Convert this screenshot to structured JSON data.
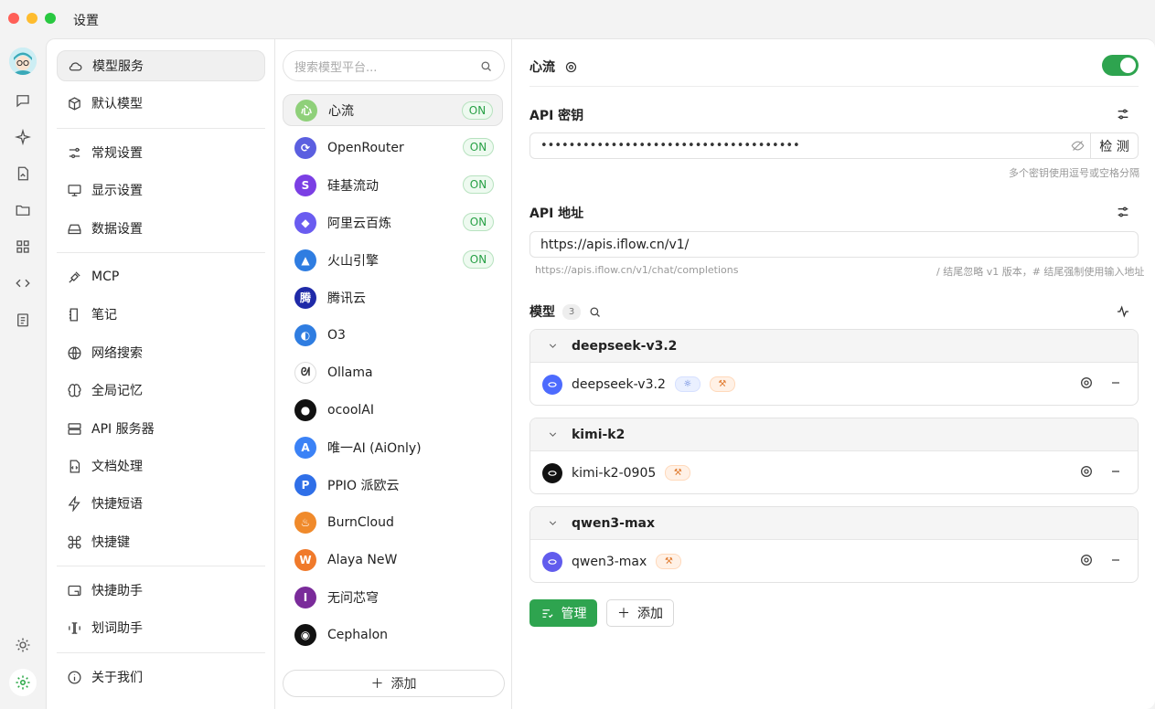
{
  "window": {
    "title": "设置"
  },
  "nav": {
    "items": [
      {
        "label": "模型服务",
        "icon": "cloud-icon"
      },
      {
        "label": "默认模型",
        "icon": "cube-icon"
      },
      {
        "label": "常规设置",
        "icon": "sliders-icon"
      },
      {
        "label": "显示设置",
        "icon": "monitor-gear-icon"
      },
      {
        "label": "数据设置",
        "icon": "hard-drive-icon"
      },
      {
        "label": "MCP",
        "icon": "plug-icon"
      },
      {
        "label": "笔记",
        "icon": "notebook-pen-icon"
      },
      {
        "label": "网络搜索",
        "icon": "globe-icon"
      },
      {
        "label": "全局记忆",
        "icon": "brain-icon"
      },
      {
        "label": "API 服务器",
        "icon": "server-icon"
      },
      {
        "label": "文档处理",
        "icon": "file-code-icon"
      },
      {
        "label": "快捷短语",
        "icon": "zap-icon"
      },
      {
        "label": "快捷键",
        "icon": "command-icon"
      },
      {
        "label": "快捷助手",
        "icon": "app-window-icon"
      },
      {
        "label": "划词助手",
        "icon": "text-cursor-icon"
      },
      {
        "label": "关于我们",
        "icon": "info-icon"
      }
    ]
  },
  "providers": {
    "search_placeholder": "搜索模型平台...",
    "items": [
      {
        "name": "心流",
        "on": "ON",
        "logo_text": "心",
        "color": "#8fd07a"
      },
      {
        "name": "OpenRouter",
        "on": "ON",
        "logo_text": "⟳",
        "color": "#5b5fe0"
      },
      {
        "name": "硅基流动",
        "on": "ON",
        "logo_text": "S",
        "color": "#7b3fe4"
      },
      {
        "name": "阿里云百炼",
        "on": "ON",
        "logo_text": "◆",
        "color": "#6a5cf0"
      },
      {
        "name": "火山引擎",
        "on": "ON",
        "logo_text": "▲",
        "color": "#2f7de1"
      },
      {
        "name": "腾讯云",
        "on": "",
        "logo_text": "腾",
        "color": "#1f2aa8"
      },
      {
        "name": "O3",
        "on": "",
        "logo_text": "◐",
        "color": "#2f7de1"
      },
      {
        "name": "Ollama",
        "on": "",
        "logo_text": "ᘛ",
        "color": "#ffffff"
      },
      {
        "name": "ocoolAI",
        "on": "",
        "logo_text": "●",
        "color": "#111111"
      },
      {
        "name": "唯一AI (AiOnly)",
        "on": "",
        "logo_text": "A",
        "color": "#3b82f6"
      },
      {
        "name": "PPIO 派欧云",
        "on": "",
        "logo_text": "P",
        "color": "#2f6fe8"
      },
      {
        "name": "BurnCloud",
        "on": "",
        "logo_text": "♨",
        "color": "#f08a2b"
      },
      {
        "name": "Alaya NeW",
        "on": "",
        "logo_text": "W",
        "color": "#f07a2b"
      },
      {
        "name": "无问芯穹",
        "on": "",
        "logo_text": "I",
        "color": "#7a2b9a"
      },
      {
        "name": "Cephalon",
        "on": "",
        "logo_text": "◉",
        "color": "#111111"
      }
    ],
    "add_label": "添加"
  },
  "detail": {
    "title": "心流",
    "enabled": true,
    "api_key": {
      "label": "API 密钥",
      "value": "•••••••••••••••••••••••••••••••••••••",
      "check_label": "检 测",
      "hint": "多个密钥使用逗号或空格分隔"
    },
    "api_url": {
      "label": "API 地址",
      "value": "https://apis.iflow.cn/v1/",
      "preview": "https://apis.iflow.cn/v1/chat/completions",
      "hint": "/ 结尾忽略 v1 版本，# 结尾强制使用输入地址"
    },
    "models": {
      "label": "模型",
      "count": "3",
      "groups": [
        {
          "name": "deepseek-v3.2",
          "model": "deepseek-v3.2",
          "logo": "whale-icon",
          "logo_color": "#4d6bfe",
          "tags": [
            "vision",
            "tool"
          ]
        },
        {
          "name": "kimi-k2",
          "model": "kimi-k2-0905",
          "logo": "kimi-icon",
          "logo_color": "#111111",
          "tags": [
            "tool"
          ]
        },
        {
          "name": "qwen3-max",
          "model": "qwen3-max",
          "logo": "qwen-icon",
          "logo_color": "#615ced",
          "tags": [
            "tool"
          ]
        }
      ]
    },
    "manage_label": "管理",
    "add_label": "添加"
  }
}
